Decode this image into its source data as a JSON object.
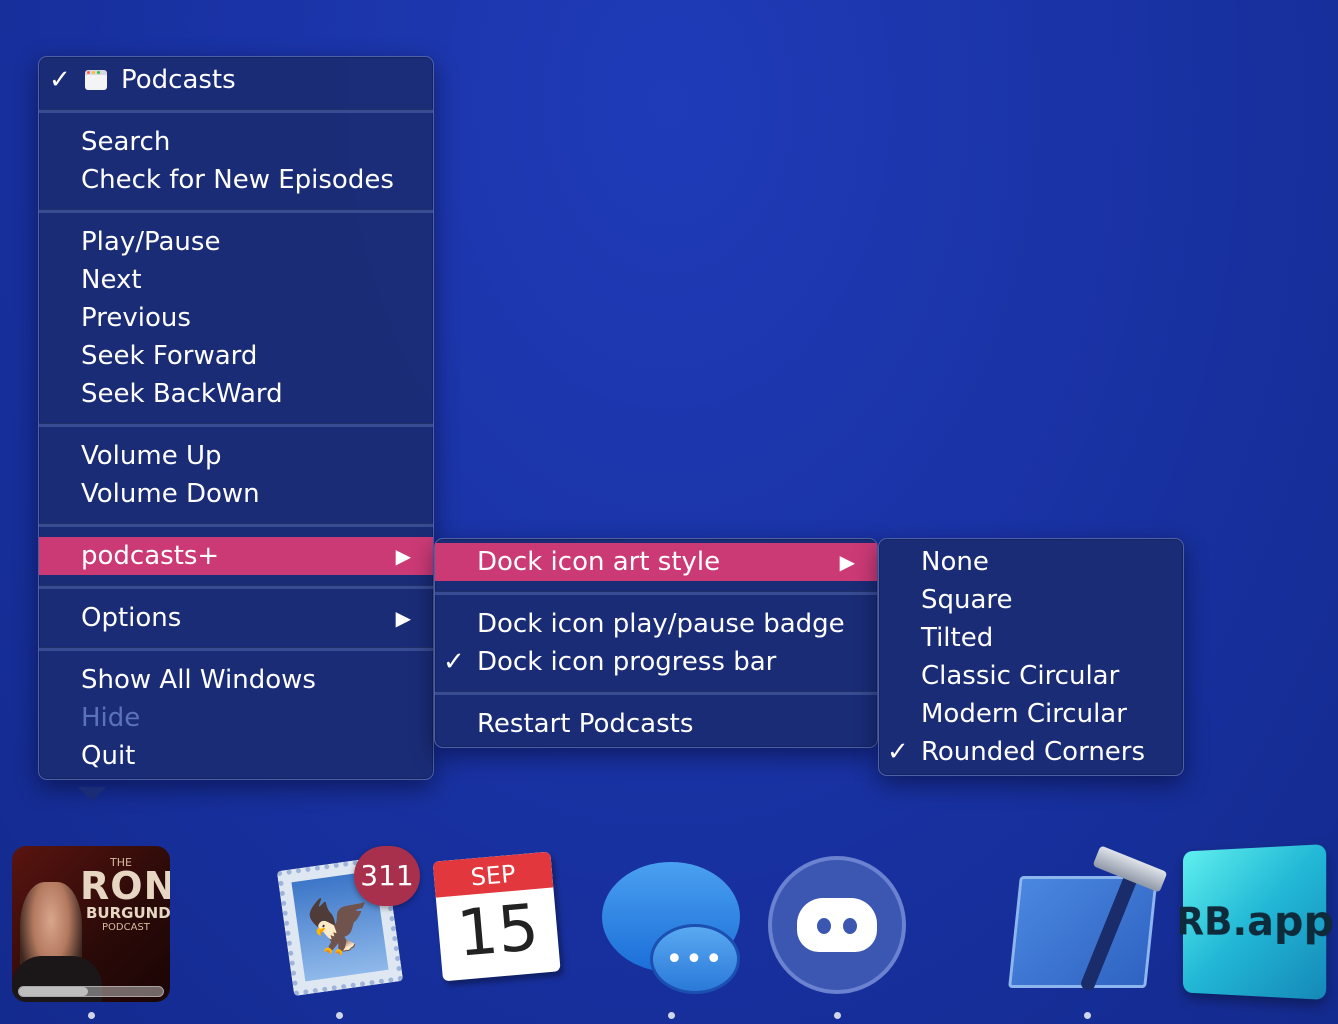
{
  "main_menu": {
    "app_title": "Podcasts",
    "app_title_checked": true,
    "group1": [
      "Search",
      "Check for New Episodes"
    ],
    "group2": [
      "Play/Pause",
      "Next",
      "Previous",
      "Seek Forward",
      "Seek BackWard"
    ],
    "group3": [
      "Volume Up",
      "Volume Down"
    ],
    "podcasts_plus": "podcasts+",
    "options": "Options",
    "group6": {
      "show_all_windows": "Show All Windows",
      "hide": "Hide",
      "quit": "Quit"
    }
  },
  "submenu_podcasts_plus": {
    "dock_icon_art_style": "Dock icon art style",
    "dock_icon_play_pause_badge": "Dock icon play/pause badge",
    "dock_icon_progress_bar": "Dock icon progress bar",
    "progress_bar_checked": true,
    "restart_podcasts": "Restart Podcasts"
  },
  "submenu_art_style": {
    "options": [
      "None",
      "Square",
      "Tilted",
      "Classic Circular",
      "Modern Circular",
      "Rounded Corners"
    ],
    "selected": "Rounded Corners"
  },
  "glyphs": {
    "check": "✓",
    "arrow": "▶",
    "eagle": "🦅",
    "ellipsis": "•••"
  },
  "dock": {
    "podcast_tile": {
      "the": "THE",
      "ron": "RON",
      "burgundy": "BURGUNDY",
      "podcast": "PODCAST",
      "progress": 0.48
    },
    "mail_badge": "311",
    "calendar_month": "SEP",
    "calendar_day": "15",
    "rb_label": "RB.app"
  },
  "colors": {
    "highlight": "#cc3a76",
    "menu_bg": "#1c2c76",
    "disabled_text": "#5a72b8",
    "desktop": "#1a33a6"
  }
}
